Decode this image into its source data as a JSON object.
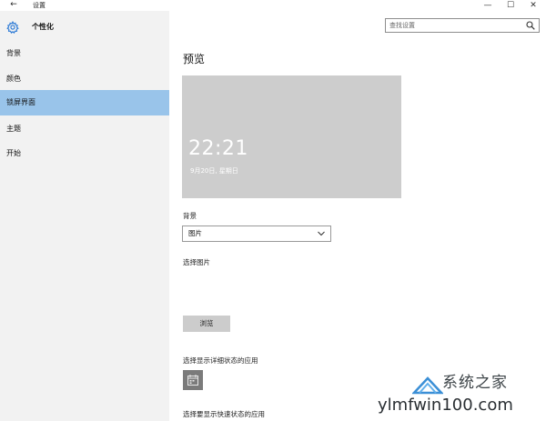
{
  "window": {
    "title": "设置",
    "back_glyph": "←",
    "minimize_glyph": "—",
    "maximize_glyph": "☐",
    "close_glyph": "✕"
  },
  "sidebar": {
    "title": "个性化",
    "items": [
      {
        "label": "背景",
        "active": false
      },
      {
        "label": "颜色",
        "active": false
      },
      {
        "label": "锁屏界面",
        "active": true
      },
      {
        "label": "主题",
        "active": false
      },
      {
        "label": "开始",
        "active": false
      }
    ]
  },
  "search": {
    "placeholder": "查找设置"
  },
  "main": {
    "preview_heading": "预览",
    "preview": {
      "time": "22:21",
      "date": "9月20日, 星期日"
    },
    "background_label": "背景",
    "background_select_value": "图片",
    "choose_picture_label": "选择图片",
    "browse_button": "浏览",
    "detailed_status_label": "选择显示详细状态的应用",
    "quick_status_label": "选择要显示快速状态的应用"
  },
  "watermark": {
    "cn": "系统之家",
    "en": "ylmfwin100.com"
  },
  "colors": {
    "sidebar_bg": "#f2f2f2",
    "active_item": "#99c4ea",
    "preview_bg": "#cdcdcd",
    "button_bg": "#cccccc",
    "accent": "#2e7bd6"
  },
  "icons": {
    "back": "back-arrow-icon",
    "settings": "gear-icon",
    "search": "search-icon",
    "dropdown": "chevron-down-icon",
    "calendar_app": "calendar-icon"
  }
}
